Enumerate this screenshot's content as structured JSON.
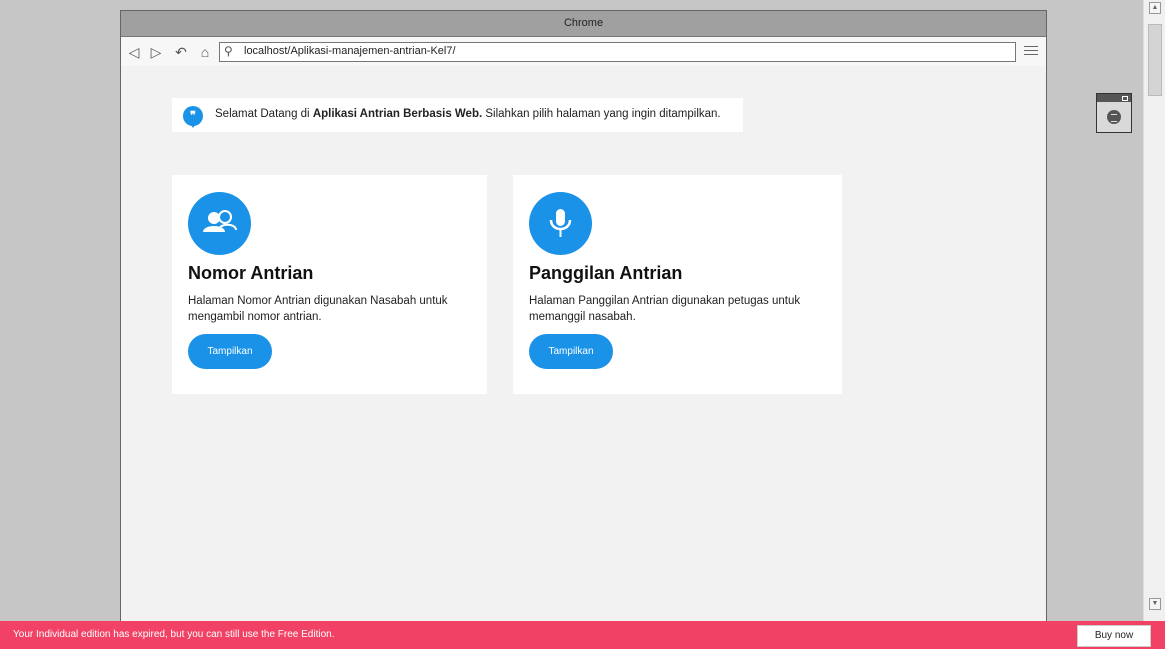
{
  "window": {
    "title": "Chrome"
  },
  "address_bar": {
    "url": "localhost/Aplikasi-manajemen-antrian-Kel7/"
  },
  "welcome": {
    "prefix": "Selamat Datang di ",
    "bold": "Aplikasi Antrian Berbasis Web.",
    "suffix": " Silahkan pilih halaman yang ingin ditampilkan."
  },
  "cards": [
    {
      "icon": "users-icon",
      "title": "Nomor Antrian",
      "description": "Halaman Nomor Antrian digunakan Nasabah untuk mengambil nomor antrian.",
      "button_label": "Tampilkan"
    },
    {
      "icon": "microphone-icon",
      "title": "Panggilan Antrian",
      "description": "Halaman Panggilan Antrian digunakan petugas untuk memanggil nasabah.",
      "button_label": "Tampilkan"
    }
  ],
  "notice": {
    "message": "Your Individual edition has expired, but you can still use the Free Edition.",
    "buy_label": "Buy now"
  },
  "colors": {
    "accent": "#1992e8",
    "notice_bar": "#f14265"
  }
}
